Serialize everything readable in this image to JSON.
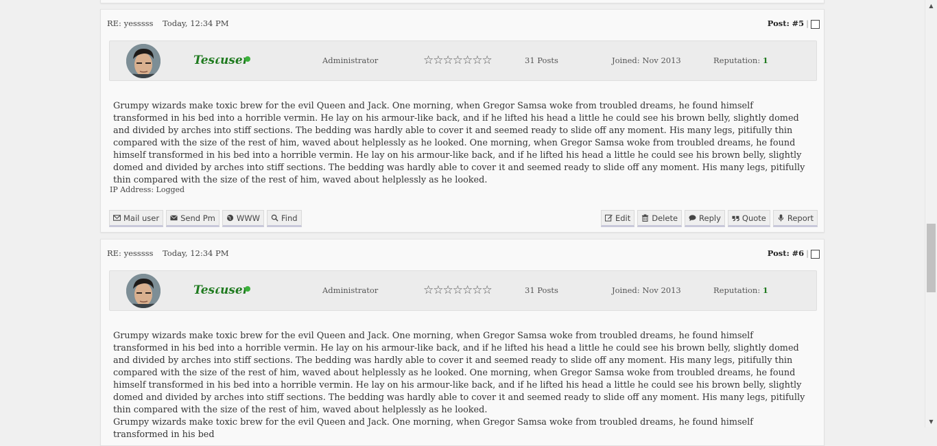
{
  "posts": [
    {
      "subject": "RE: yesssss",
      "date": "Today, 12:34 PM",
      "post_label": "Post:",
      "post_number": "#5",
      "separator": "|",
      "user": {
        "name": "Testuser",
        "role": "Administrator",
        "stars": "☆☆☆☆☆☆☆",
        "posts": "31 Posts",
        "joined": "Joined: Nov 2013",
        "reputation_label": "Reputation:",
        "reputation_value": "1"
      },
      "body": "Grumpy wizards make toxic brew for the evil Queen and Jack. One morning, when Gregor Samsa woke from troubled dreams, he found himself transformed in his bed into a horrible vermin. He lay on his armour-like back, and if he lifted his head a little he could see his brown belly, slightly domed and divided by arches into stiff sections. The bedding was hardly able to cover it and seemed ready to slide off any moment. His many legs, pitifully thin compared with the size of the rest of him, waved about helplessly as he looked. One morning, when Gregor Samsa woke from troubled dreams, he found himself transformed in his bed into a horrible vermin. He lay on his armour-like back, and if he lifted his head a little he could see his brown belly, slightly domed and divided by arches into stiff sections. The bedding was hardly able to cover it and seemed ready to slide off any moment. His many legs, pitifully thin compared with the size of the rest of him, waved about helplessly as he looked.",
      "ip": "IP Address: Logged",
      "left_buttons": [
        "Mail user",
        "Send Pm",
        "WWW",
        "Find"
      ],
      "right_buttons": [
        "Edit",
        "Delete",
        "Reply",
        "Quote",
        "Report"
      ]
    },
    {
      "subject": "RE: yesssss",
      "date": "Today, 12:34 PM",
      "post_label": "Post:",
      "post_number": "#6",
      "separator": "|",
      "user": {
        "name": "Testuser",
        "role": "Administrator",
        "stars": "☆☆☆☆☆☆☆",
        "posts": "31 Posts",
        "joined": "Joined: Nov 2013",
        "reputation_label": "Reputation:",
        "reputation_value": "1"
      },
      "body": "Grumpy wizards make toxic brew for the evil Queen and Jack. One morning, when Gregor Samsa woke from troubled dreams, he found himself transformed in his bed into a horrible vermin. He lay on his armour-like back, and if he lifted his head a little he could see his brown belly, slightly domed and divided by arches into stiff sections. The bedding was hardly able to cover it and seemed ready to slide off any moment. His many legs, pitifully thin compared with the size of the rest of him, waved about helplessly as he looked. One morning, when Gregor Samsa woke from troubled dreams, he found himself transformed in his bed into a horrible vermin. He lay on his armour-like back, and if he lifted his head a little he could see his brown belly, slightly domed and divided by arches into stiff sections. The bedding was hardly able to cover it and seemed ready to slide off any moment. His many legs, pitifully thin compared with the size of the rest of him, waved about helplessly as he looked.",
      "body_2": "Grumpy wizards make toxic brew for the evil Queen and Jack. One morning, when Gregor Samsa woke from troubled dreams, he found himself transformed in his bed"
    }
  ],
  "colors": {
    "username": "#1f7a1f",
    "online": "#3cb13c",
    "page_bg": "#f0f0f0",
    "post_bg": "#f9f9f9",
    "userbar_bg": "#ececec"
  },
  "icons": {
    "mail": "envelope-icon",
    "pm": "envelope-icon",
    "www": "globe-icon",
    "find": "search-icon",
    "edit": "edit-icon",
    "delete": "trash-icon",
    "reply": "comment-icon",
    "quote": "quote-icon",
    "report": "microphone-icon"
  }
}
